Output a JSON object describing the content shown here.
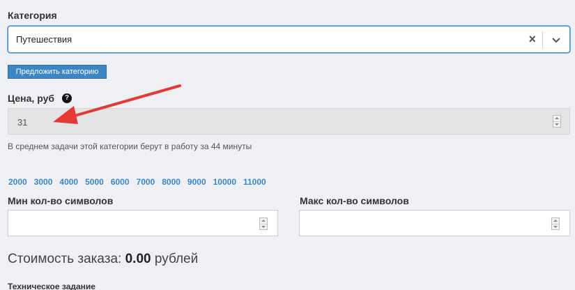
{
  "category": {
    "label": "Категория",
    "selected": "Путешествия",
    "clear_glyph": "×"
  },
  "suggest_button": "Предложить категорию",
  "price": {
    "label": "Цена, руб",
    "help_glyph": "?",
    "value": "31",
    "hint": "В среднем задачи этой категории берут в работу за 44 минуты"
  },
  "quick_values": [
    "2000",
    "3000",
    "4000",
    "5000",
    "6000",
    "7000",
    "8000",
    "9000",
    "10000",
    "11000"
  ],
  "min_chars": {
    "label": "Мин кол-во символов",
    "value": ""
  },
  "max_chars": {
    "label": "Макс кол-во символов",
    "value": ""
  },
  "cost": {
    "prefix": "Стоимость заказа:",
    "amount": "0.00",
    "suffix": "рублей"
  },
  "tech_task_label": "Техническое задание",
  "colors": {
    "accent": "#3b87c6",
    "annotation_arrow": "#e53935"
  }
}
